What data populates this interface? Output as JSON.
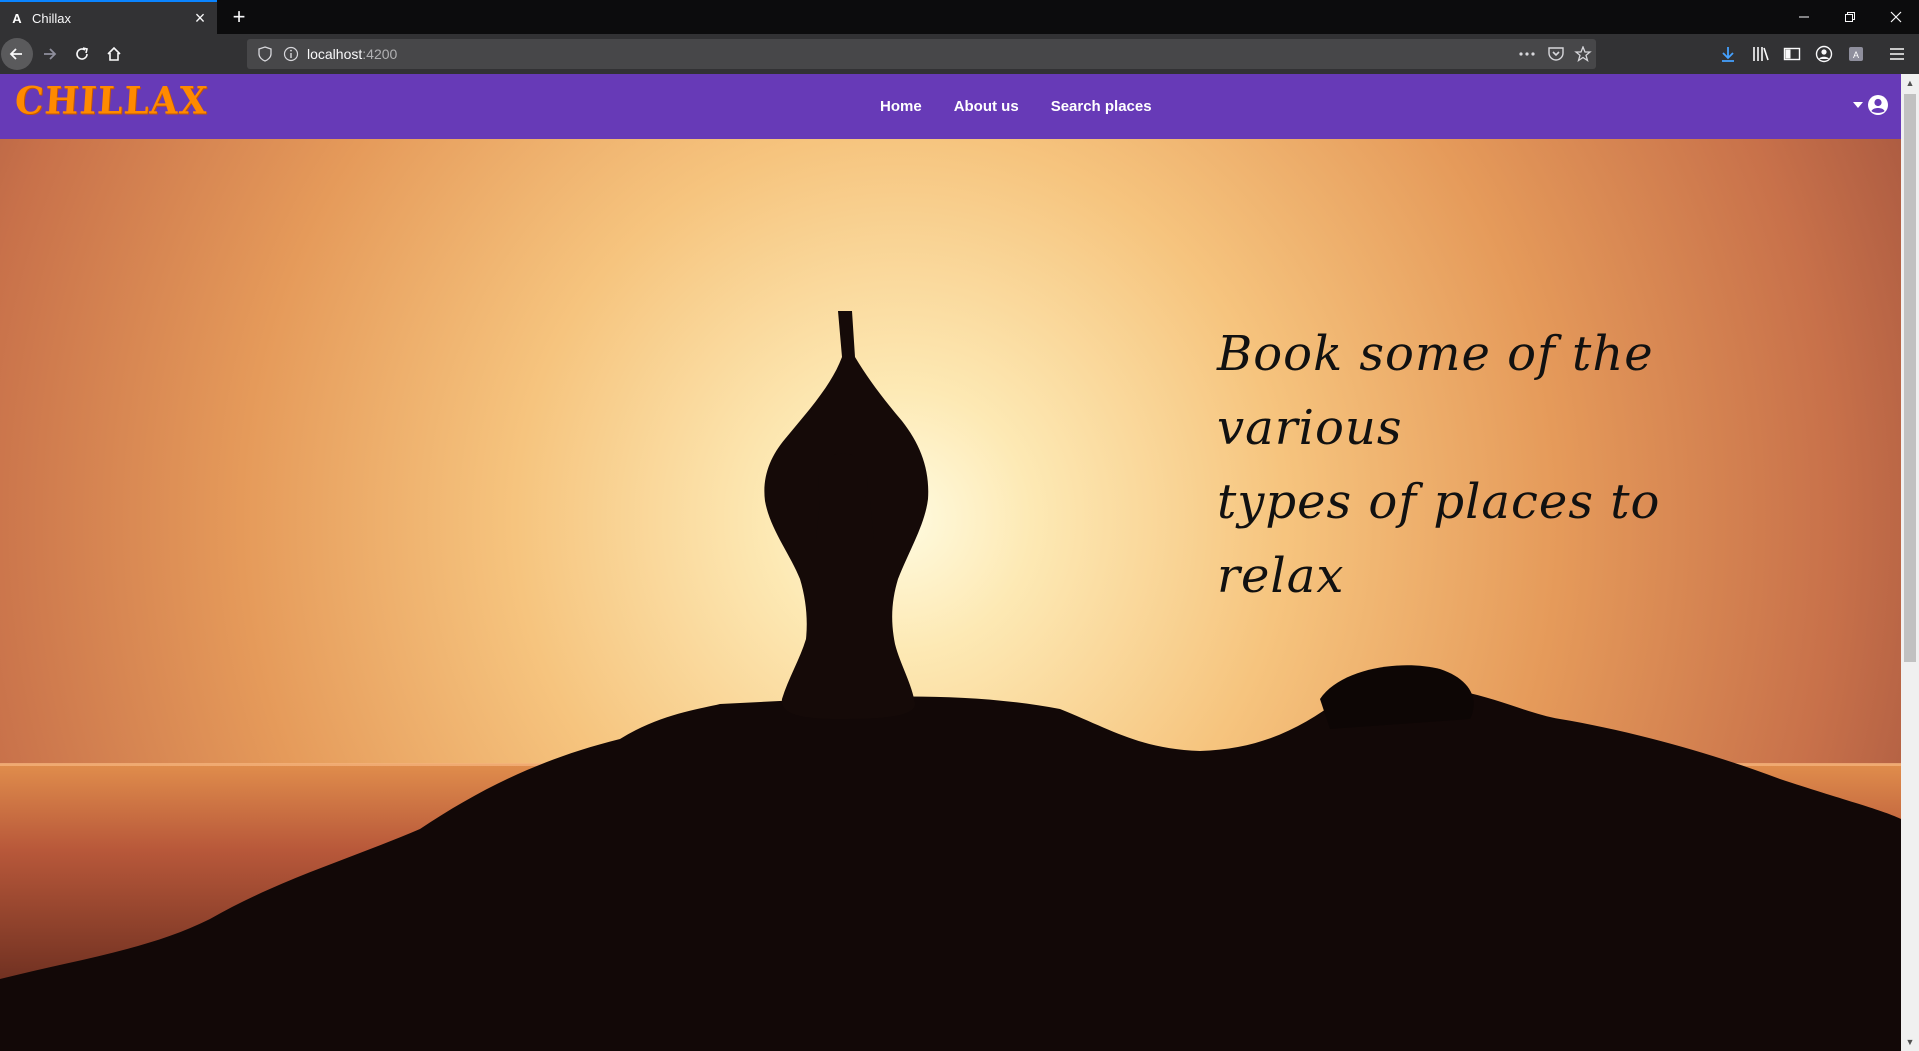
{
  "browser": {
    "tab_title": "Chillax",
    "tab_favicon": "A",
    "url_host": "localhost",
    "url_port": ":4200",
    "icons": [
      "back-icon",
      "forward-icon",
      "reload-icon",
      "home-icon",
      "shield-icon",
      "info-icon",
      "more-icon",
      "pocket-icon",
      "bookmark-star-icon",
      "download-icon",
      "library-icon",
      "sidebar-icon",
      "account-icon",
      "extension-icon",
      "menu-icon"
    ]
  },
  "site": {
    "logo": "CHILLAX",
    "nav": [
      "Home",
      "About us",
      "Search places"
    ],
    "hero_line1": "Book some of the various",
    "hero_line2": "types of places to relax"
  },
  "colors": {
    "header_bg": "#673ab7",
    "logo": "#ff8a00",
    "accent": "#0a84ff"
  }
}
